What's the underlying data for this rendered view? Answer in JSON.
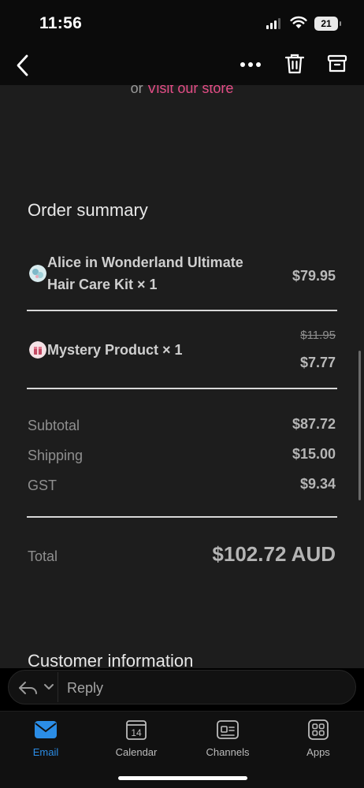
{
  "status_bar": {
    "time": "11:56",
    "battery": "21"
  },
  "store_line": {
    "prefix": "or",
    "link": "Visit our store"
  },
  "order_summary": {
    "title": "Order summary",
    "items": [
      {
        "name_line1": "Alice in Wonderland Ultimate",
        "name_line2": "Hair Care Kit × 1",
        "price": "$79.95"
      },
      {
        "name": "Mystery Product × 1",
        "original_price": "$11.95",
        "price": "$7.77"
      }
    ],
    "subtotal_label": "Subtotal",
    "subtotal": "$87.72",
    "shipping_label": "Shipping",
    "shipping": "$15.00",
    "gst_label": "GST",
    "gst": "$9.34",
    "total_label": "Total",
    "total": "$102.72 AUD"
  },
  "customer_info_title": "Customer information",
  "reply": {
    "label": "Reply"
  },
  "tabs": [
    {
      "label": "Email"
    },
    {
      "label": "Calendar",
      "date": "14"
    },
    {
      "label": "Channels"
    },
    {
      "label": "Apps"
    }
  ],
  "colors": {
    "link": "#e44d86",
    "active_tab": "#2b8de6",
    "background": "#1d1d1d"
  }
}
